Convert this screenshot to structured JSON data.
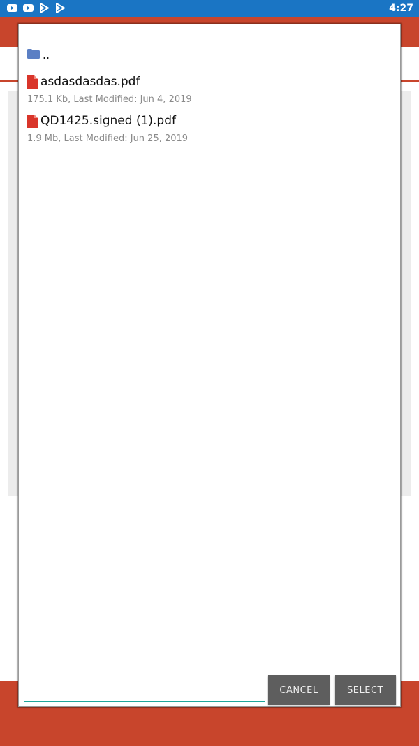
{
  "status_bar": {
    "time": "4:27",
    "icons": [
      "youtube-icon",
      "youtube-icon",
      "play-store-icon",
      "play-store-icon"
    ]
  },
  "dialog": {
    "parent_dir_label": "..",
    "files": [
      {
        "name": "asdasdasdas.pdf",
        "meta": "175.1 Kb, Last Modified: Jun 4, 2019"
      },
      {
        "name": "QD1425.signed (1).pdf",
        "meta": "1.9 Mb, Last Modified: Jun 25, 2019"
      }
    ],
    "filename_value": "",
    "cancel_label": "CANCEL",
    "select_label": "SELECT"
  },
  "colors": {
    "status_bar": "#1a75c4",
    "app_accent": "#c8452c",
    "input_underline": "#1ea59a",
    "pdf_icon": "#d9352a",
    "folder_icon": "#5b7fc4",
    "button_bg": "#5e5e5e"
  }
}
